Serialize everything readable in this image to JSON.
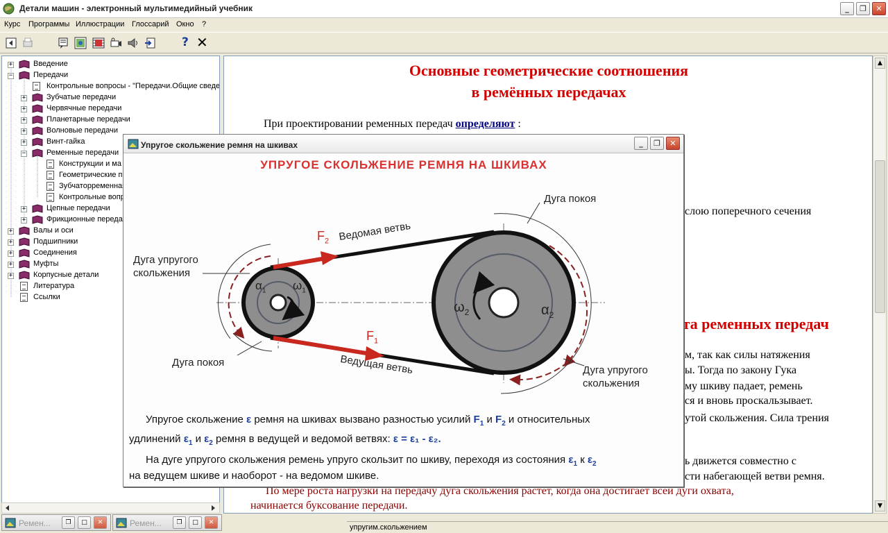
{
  "window": {
    "title": "Детали машин - электронный мультимедийный учебник",
    "min": "_",
    "max": "❐",
    "close": "✕"
  },
  "menu": [
    "Курс",
    "Программы",
    "Иллюстрации",
    "Глоссарий",
    "Окно",
    "?"
  ],
  "toolbar": {
    "buttons": [
      "back-icon",
      "print-icon",
      "notes-icon",
      "image-icon",
      "video-icon",
      "camera-icon",
      "sound-icon",
      "export-icon",
      "help-icon",
      "exit-icon"
    ],
    "help_glyph": "?",
    "exit_glyph": "✕"
  },
  "tree": {
    "items": [
      {
        "label": "Введение",
        "exp": "+"
      },
      {
        "label": "Передачи",
        "exp": "−"
      },
      {
        "label": "Контрольные вопросы - \"Передачи.Общие сведе",
        "exp": ""
      },
      {
        "label": "Зубчатые передачи",
        "exp": "+"
      },
      {
        "label": "Червячные передачи",
        "exp": "+"
      },
      {
        "label": "Планетарные передачи",
        "exp": "+"
      },
      {
        "label": "Волновые передачи",
        "exp": "+"
      },
      {
        "label": "Винт-гайка",
        "exp": "+"
      },
      {
        "label": "Ременные передачи",
        "exp": "−"
      },
      {
        "label": "Конструкции и ма",
        "exp": ""
      },
      {
        "label": "Геометрические п",
        "exp": ""
      },
      {
        "label": "Зубчаторременная",
        "exp": ""
      },
      {
        "label": "Контрольные вопр",
        "exp": ""
      },
      {
        "label": "Цепные передачи",
        "exp": "+"
      },
      {
        "label": "Фрикционные переда",
        "exp": "+"
      },
      {
        "label": "Валы и оси",
        "exp": "+"
      },
      {
        "label": "Подшипники",
        "exp": "+"
      },
      {
        "label": "Соединения",
        "exp": "+"
      },
      {
        "label": "Муфты",
        "exp": "+"
      },
      {
        "label": "Корпусные детали",
        "exp": "+"
      },
      {
        "label": "Литература",
        "exp": ""
      },
      {
        "label": "Ссылки",
        "exp": ""
      }
    ]
  },
  "content": {
    "heading_line1": "Основные геометрические соотношения",
    "heading_line2": "в ремённых передачах",
    "intro_text": "При проектировании ременных передач",
    "intro_link": "определяют",
    "intro_colon": ":",
    "fragment_section": "слою поперечного сечения",
    "heading2_fragment": "ота ременных передач",
    "p1": "м, так как силы натяжения",
    "p2": "ы. Тогда по закону Гука",
    "p3": "му шкиву падает, ремень",
    "p4": "ся и вновь проскальзывает.",
    "p5": "утой скольжения. Сила трения",
    "p6": "ь движется совместно с",
    "p7": "сти набегающей ветви ремня.",
    "p8": "По мере роста нагрузки на передачу дуга скольжения растет, когда она достигает всей дуги охвата,",
    "p9": "начинается буксование передачи."
  },
  "popup": {
    "title": "Упругое скольжение ремня на шкивах",
    "diagram_title": "УПРУГОЕ СКОЛЬЖЕНИЕ РЕМНЯ НА ШКИВАХ",
    "labels": {
      "arc_rest_right": "Дуга покоя",
      "arc_slip_left_1": "Дуга упругого",
      "arc_slip_left_2": "скольжения",
      "arc_rest_left": "Дуга покоя",
      "arc_slip_right_1": "Дуга упругого",
      "arc_slip_right_2": "скольжения",
      "driven_branch": "Ведомая ветвь",
      "driving_branch": "Ведущая ветвь",
      "f2": "F",
      "f2_sub": "2",
      "f1": "F",
      "f1_sub": "1",
      "alpha1": "α",
      "alpha1_sub": "1",
      "omega1": "ω",
      "omega1_sub": "1",
      "alpha2": "α",
      "alpha2_sub": "2",
      "omega2": "ω",
      "omega2_sub": "2"
    },
    "caption": {
      "l1a": "Упругое скольжение",
      "l1eps": "ε",
      "l1b": "ремня на шкивах вызвано разностью усилий",
      "l1f1": "F",
      "l1f1s": "1",
      "l1and": "и",
      "l1f2": "F",
      "l1f2s": "2",
      "l1c": "и относительных",
      "l2a": "удлинений",
      "l2e1": "ε",
      "l2e1s": "1",
      "l2and": "и",
      "l2e2": "ε",
      "l2e2s": "2",
      "l2b": "ремня в ведущей и ведомой ветвях:",
      "l2formula": "ε = ε₁ - ε₂.",
      "l3a": "На дуге упругого скольжения ремень упруго скользит по шкиву, переходя из состояния",
      "l3e1": "ε",
      "l3e1s": "1",
      "l3k": "к",
      "l3e2": "ε",
      "l3e2s": "2",
      "l4": "на ведущем шкиве и наоборот - на ведомом шкиве."
    }
  },
  "taskbar": {
    "win1": "Ремен...",
    "win2": "Ремен..."
  },
  "status": "упругим.скольжением",
  "colors": {
    "heading": "#d40000",
    "arrow_red": "#c8281e",
    "pulley": "#8e8e8e",
    "belt": "#111111"
  }
}
